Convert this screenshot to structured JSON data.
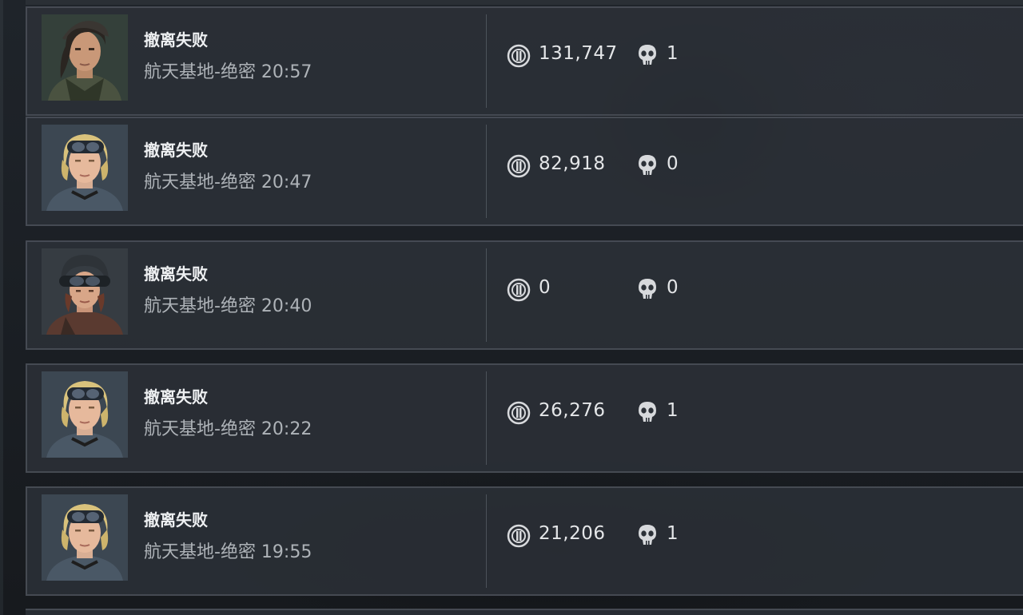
{
  "records": [
    {
      "status": "撤离失败",
      "map_time": "航天基地-绝密 20:57",
      "value": "131,747",
      "kills": "1",
      "avatar": "dark-hair-operator-avatar"
    },
    {
      "status": "撤离失败",
      "map_time": "航天基地-绝密 20:47",
      "value": "82,918",
      "kills": "0",
      "avatar": "blonde-goggles-operator-avatar"
    },
    {
      "status": "撤离失败",
      "map_time": "航天基地-绝密 20:40",
      "value": "0",
      "kills": "0",
      "avatar": "helmet-goggles-operator-avatar"
    },
    {
      "status": "撤离失败",
      "map_time": "航天基地-绝密 20:22",
      "value": "26,276",
      "kills": "1",
      "avatar": "blonde-goggles-operator-avatar"
    },
    {
      "status": "撤离失败",
      "map_time": "航天基地-绝密 19:55",
      "value": "21,206",
      "kills": "1",
      "avatar": "blonde-goggles-operator-avatar"
    }
  ],
  "icons": {
    "value": "coin-icon",
    "kills": "skull-icon"
  },
  "colors": {
    "card_background": "#2c3138",
    "card_border": "#5c636c",
    "status_text": "#eef0f2",
    "sub_text": "#aeb3b8"
  }
}
